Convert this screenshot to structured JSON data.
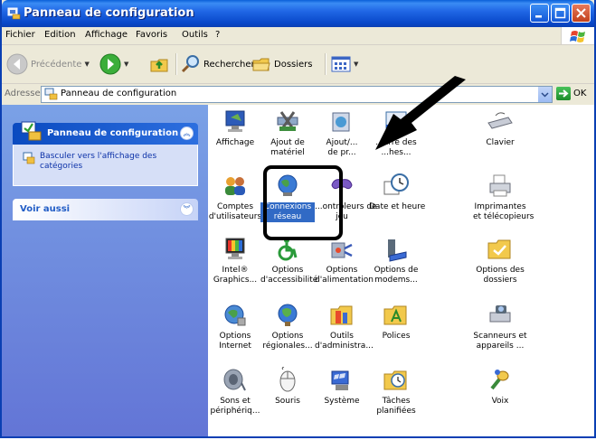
{
  "window": {
    "title": "Panneau de configuration"
  },
  "menu": [
    "Fichier",
    "Edition",
    "Affichage",
    "Favoris",
    "Outils",
    "?"
  ],
  "toolbar": {
    "back": "Précédente",
    "search": "Rechercher",
    "folders": "Dossiers"
  },
  "address": {
    "label": "Adresse",
    "value": "Panneau de configuration",
    "go": "OK"
  },
  "taskpane": {
    "panel_title": "Panneau de configuration",
    "switch_link": "Basculer vers l'affichage des catégories",
    "see_also": "Voir aussi"
  },
  "items": [
    {
      "label": "Affichage",
      "icon": "display-icon"
    },
    {
      "label": "Ajout de\nmatériel",
      "icon": "add-hardware-icon"
    },
    {
      "label": "Ajout/...\nde pr...",
      "icon": "add-remove-programs-icon"
    },
    {
      "label": "...arre des\n...hes...",
      "icon": "taskbar-icon"
    },
    {
      "label": "Clavier",
      "icon": "keyboard-icon"
    },
    {
      "label": "Comptes\nd'utilisateurs",
      "icon": "user-accounts-icon"
    },
    {
      "label": "Connexions\nréseau",
      "icon": "network-connections-icon",
      "selected": true
    },
    {
      "label": "...ontrôleurs de\njeu",
      "icon": "game-controllers-icon"
    },
    {
      "label": "Date et heure",
      "icon": "date-time-icon"
    },
    {
      "label": "Imprimantes\net télécopieurs",
      "icon": "printers-icon"
    },
    {
      "label": "Intel®\nGraphics...",
      "icon": "intel-graphics-icon"
    },
    {
      "label": "Options\nd'accessibilité",
      "icon": "accessibility-icon"
    },
    {
      "label": "Options\nd'alimentation",
      "icon": "power-options-icon"
    },
    {
      "label": "Options de\nmodems...",
      "icon": "modem-icon"
    },
    {
      "label": "Options des\ndossiers",
      "icon": "folder-options-icon"
    },
    {
      "label": "Options\nInternet",
      "icon": "internet-options-icon"
    },
    {
      "label": "Options\nrégionales...",
      "icon": "regional-options-icon"
    },
    {
      "label": "Outils\nd'administra...",
      "icon": "admin-tools-icon"
    },
    {
      "label": "Polices",
      "icon": "fonts-icon"
    },
    {
      "label": "Scanneurs et\nappareils ...",
      "icon": "scanners-icon"
    },
    {
      "label": "Sons et\npériphériq...",
      "icon": "sounds-icon"
    },
    {
      "label": "Souris",
      "icon": "mouse-icon"
    },
    {
      "label": "Système",
      "icon": "system-icon"
    },
    {
      "label": "Tâches\nplanifiées",
      "icon": "scheduled-tasks-icon"
    },
    {
      "label": "Voix",
      "icon": "speech-icon"
    }
  ]
}
